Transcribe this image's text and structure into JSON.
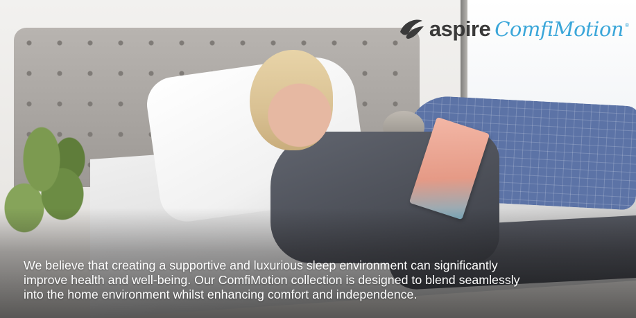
{
  "logo": {
    "brand": "aspire",
    "product": "ComfiMotion",
    "registered_mark": "®",
    "icon": "aspire-swoosh-icon"
  },
  "caption": {
    "lines": [
      "We believe that creating a supportive and luxurious sleep environment can significantly",
      "improve health and well-being. Our ComfiMotion collection is designed to blend seamlessly",
      "into the home environment whilst enhancing comfort and independence."
    ]
  },
  "colors": {
    "brand_dark": "#3a3a3a",
    "brand_blue": "#3aa6d9",
    "caption_text": "#ffffff"
  }
}
